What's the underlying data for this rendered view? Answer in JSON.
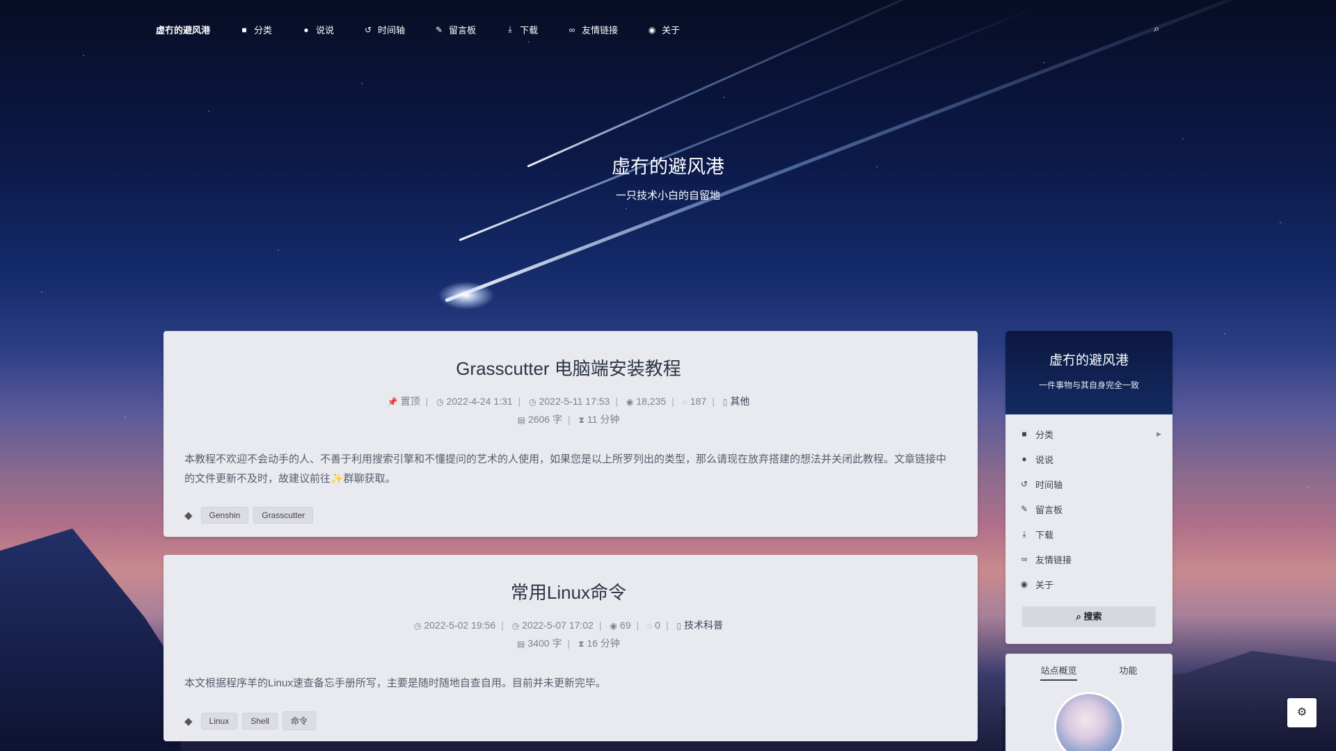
{
  "nav": {
    "brand": "虚冇的避风港",
    "items": [
      {
        "icon": "bookmark-icon",
        "glyph": "■",
        "label": "分类"
      },
      {
        "icon": "comment-icon",
        "glyph": "●",
        "label": "说说"
      },
      {
        "icon": "history-icon",
        "glyph": "↺",
        "label": "时间轴"
      },
      {
        "icon": "edit-icon",
        "glyph": "✎",
        "label": "留言板"
      },
      {
        "icon": "download-icon",
        "glyph": "⤓",
        "label": "下载"
      },
      {
        "icon": "link-icon",
        "glyph": "∞",
        "label": "友情链接"
      },
      {
        "icon": "user-circle-icon",
        "glyph": "◉",
        "label": "关于"
      }
    ]
  },
  "hero": {
    "title": "虚冇的避风港",
    "subtitle": "一只技术小白的自留地"
  },
  "posts": [
    {
      "title": "Grasscutter 电脑端安装教程",
      "pinned": "置顶",
      "created": "2022-4-24 1:31",
      "updated": "2022-5-11 17:53",
      "views": "18,235",
      "comments": "187",
      "category": "其他",
      "words": "2606 字",
      "read_time": "11 分钟",
      "excerpt": "本教程不欢迎不会动手的人、不善于利用搜索引擎和不懂提问的艺术的人使用，如果您是以上所罗列出的类型，那么请现在放弃搭建的想法并关闭此教程。文章链接中的文件更新不及时，故建议前往✨群聊获取。",
      "tags": [
        "Genshin",
        "Grasscutter"
      ]
    },
    {
      "title": "常用Linux命令",
      "created": "2022-5-02 19:56",
      "updated": "2022-5-07 17:02",
      "views": "69",
      "comments": "0",
      "category": "技术科普",
      "words": "3400 字",
      "read_time": "16 分钟",
      "excerpt": "本文根据程序羊的Linux速查备忘手册所写，主要是随时随地自查自用。目前并未更新完毕。",
      "tags": [
        "Linux",
        "Shell",
        "命令"
      ]
    }
  ],
  "sidebar": {
    "title": "虚冇的避风港",
    "subtitle": "一件事物与其自身完全一致",
    "menu": [
      {
        "icon": "bookmark-icon",
        "glyph": "■",
        "label": "分类",
        "has_arrow": true
      },
      {
        "icon": "comment-icon",
        "glyph": "●",
        "label": "说说"
      },
      {
        "icon": "history-icon",
        "glyph": "↺",
        "label": "时间轴"
      },
      {
        "icon": "edit-icon",
        "glyph": "✎",
        "label": "留言板"
      },
      {
        "icon": "download-icon",
        "glyph": "⤓",
        "label": "下载"
      },
      {
        "icon": "link-icon",
        "glyph": "∞",
        "label": "友情链接"
      },
      {
        "icon": "user-circle-icon",
        "glyph": "◉",
        "label": "关于"
      }
    ],
    "search_label": "搜索",
    "tabs": [
      "站点概览",
      "功能"
    ]
  }
}
